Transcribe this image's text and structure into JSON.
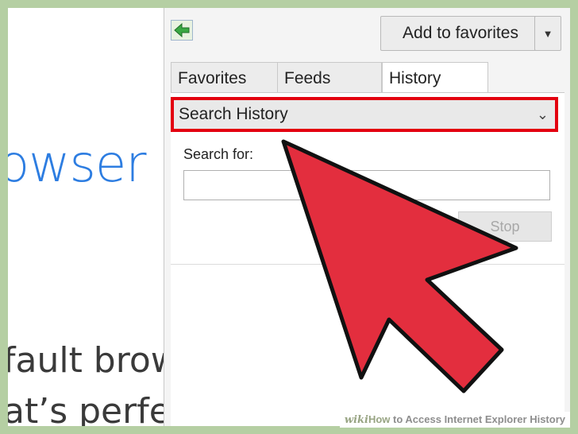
{
  "background_page": {
    "heading_fragment": "owser",
    "line1_fragment": "fault brows",
    "line2_fragment": "at’s perfec"
  },
  "favorites_pane": {
    "add_to_favorites_label": "Add to favorites",
    "tabs": [
      {
        "label": "Favorites"
      },
      {
        "label": "Feeds"
      },
      {
        "label": "History"
      }
    ],
    "active_tab": "History",
    "search_select_value": "Search History",
    "search_for_label": "Search for:",
    "search_input_value": "",
    "stop_button_label": "Stop"
  },
  "annotation": {
    "arrow_color": "#e32e3e",
    "highlight_color": "#e3000f"
  },
  "watermark": {
    "wiki": "wiki",
    "how": "How",
    "title": " to Access Internet Explorer History"
  },
  "colors": {
    "accent_blue": "#2d7de1",
    "frame_green": "#b5cfa3"
  }
}
